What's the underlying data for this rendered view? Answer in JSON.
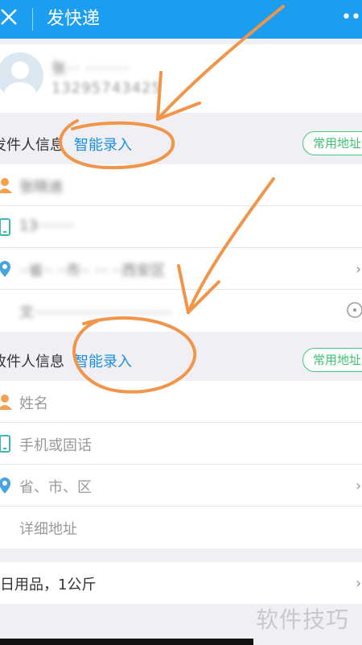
{
  "header": {
    "title": "发快递",
    "more_label": "••",
    "bg_color": "#1b9df0"
  },
  "profile": {
    "name": "张·· ·······",
    "phone": "13295743425"
  },
  "sender": {
    "section_label": "发件人信息",
    "smart_label": "智能录入",
    "common_addr_label": "常用地址",
    "name_value": "张晓迪",
    "phone_value": "13········",
    "region_value": "··省·· ··市·· ··· ··西安区",
    "address_value": "文······························"
  },
  "receiver": {
    "section_label": "收件人信息",
    "smart_label": "智能录入",
    "common_addr_label": "常用地址",
    "name_placeholder": "姓名",
    "phone_placeholder": "手机或固话",
    "region_placeholder": "省、市、区",
    "address_placeholder": "详细地址"
  },
  "goods": {
    "text": "日用品，1公斤"
  },
  "watermark": "软件技巧",
  "colors": {
    "accent_blue": "#1b8fe0",
    "chip_green": "#3fbf73",
    "person_orange": "#f2a14c",
    "phone_teal": "#3bb8b0",
    "pin_blue": "#4aa3e0",
    "annotation_orange": "#f0954a"
  }
}
